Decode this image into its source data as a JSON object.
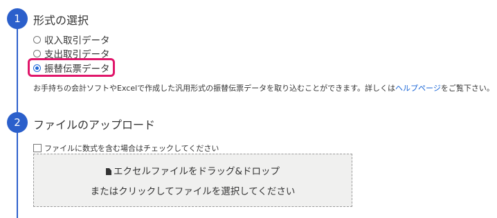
{
  "step1": {
    "number": "1",
    "title": "形式の選択",
    "options": [
      {
        "label": "収入取引データ",
        "checked": false
      },
      {
        "label": "支出取引データ",
        "checked": false
      },
      {
        "label": "振替伝票データ",
        "checked": true
      }
    ],
    "description_before": "お手持ちの会計ソフトやExcelで作成した汎用形式の振替伝票データを取り込むことができます。詳しくは",
    "help_link": "ヘルプページ",
    "description_after": "をご覧下さい。",
    "highlight_color": "#e0166a"
  },
  "step2": {
    "number": "2",
    "title": "ファイルのアップロード",
    "checkbox_label": "ファイルに数式を含む場合はチェックしてください",
    "checkbox_checked": false,
    "dropzone": {
      "line1": "エクセルファイルをドラッグ&ドロップ",
      "line2": "またはクリックしてファイルを選択してください",
      "icon": "file-icon"
    }
  },
  "colors": {
    "accent": "#2b5fcb",
    "link": "#1a66d6",
    "dropzone_bg": "#f0f0ef"
  }
}
